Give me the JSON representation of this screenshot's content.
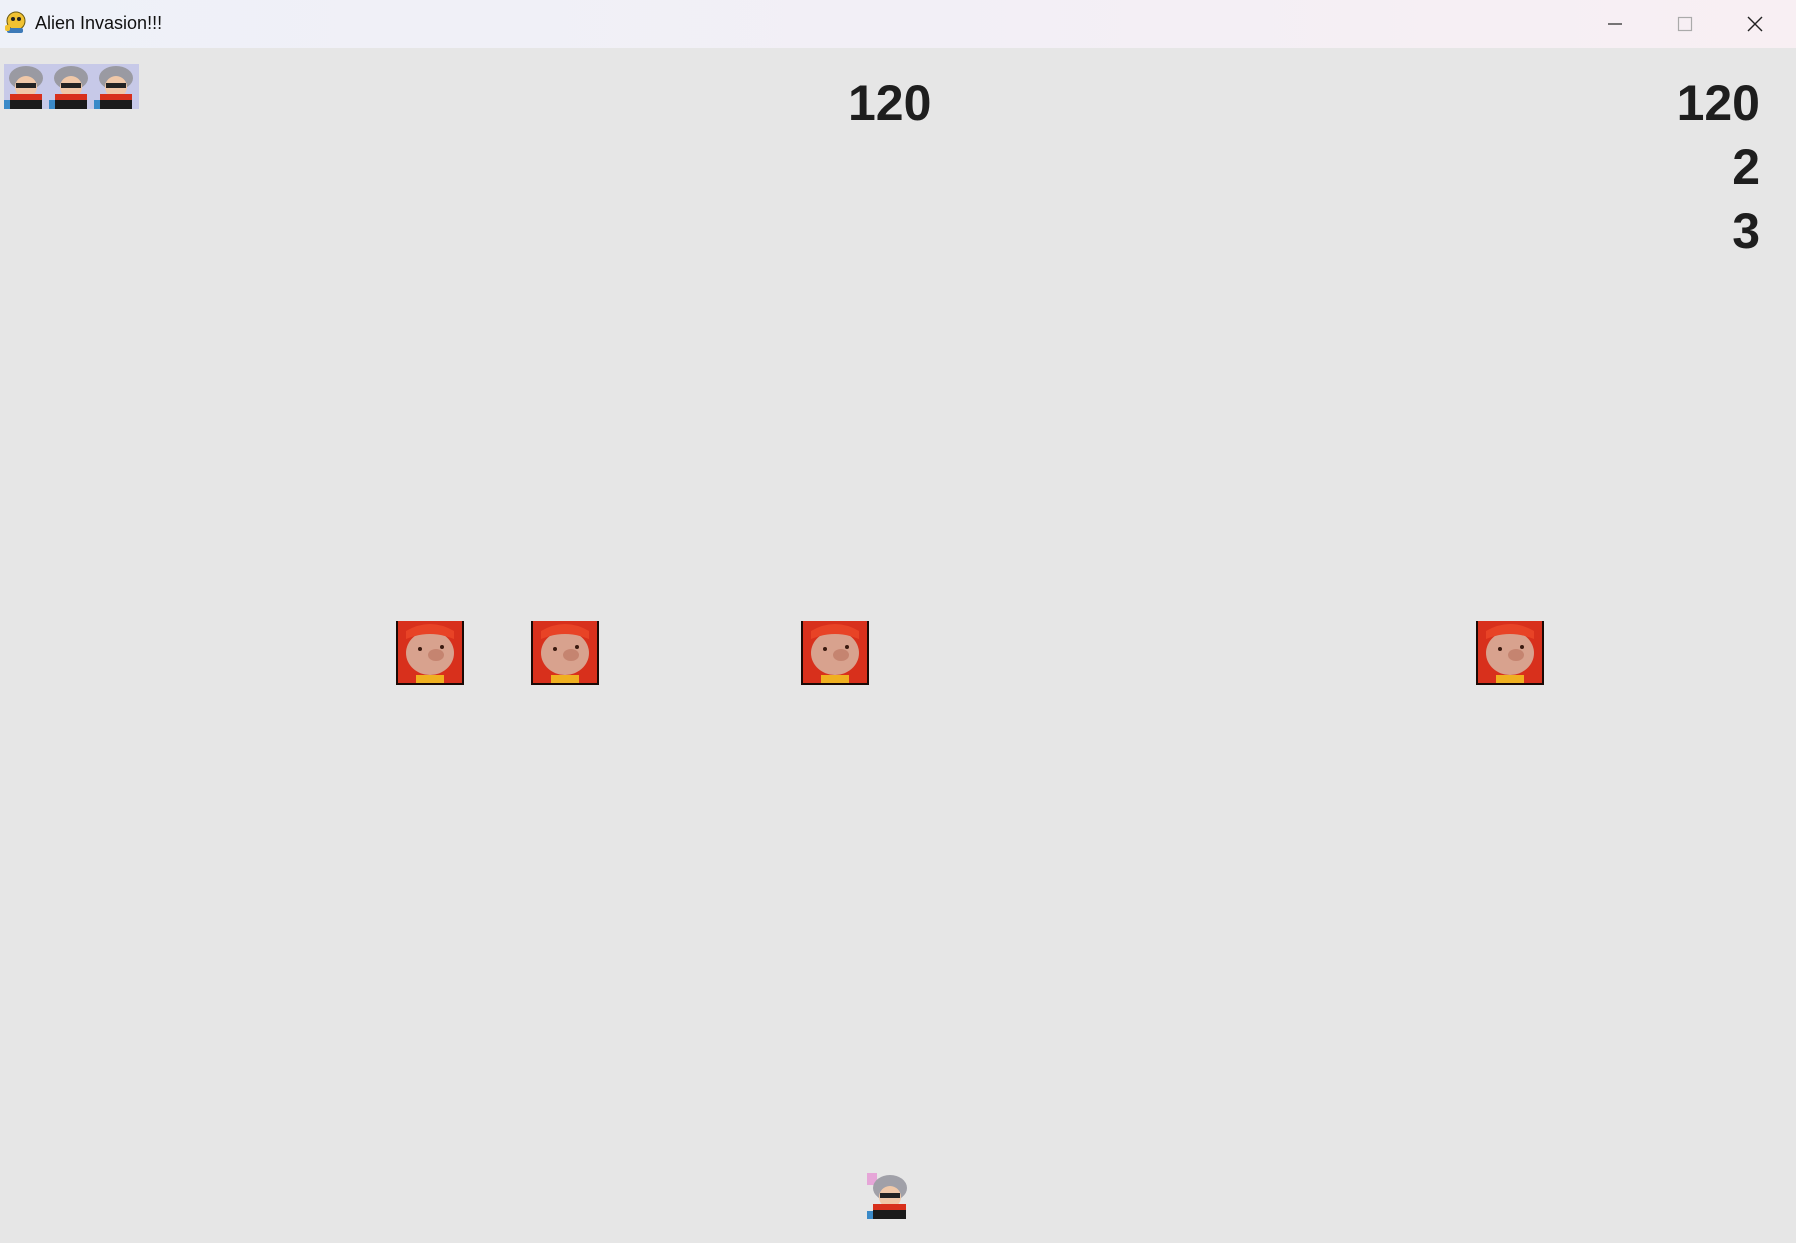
{
  "window": {
    "title": "Alien Invasion!!!",
    "app_icon": "python-icon",
    "controls": {
      "minimize": "minimize-icon",
      "maximize": "maximize-icon",
      "close": "close-icon"
    }
  },
  "hud": {
    "score": "120",
    "high_score": "120",
    "level": "2",
    "ships_left": "3",
    "lives_icons": [
      "ship-icon",
      "ship-icon",
      "ship-icon"
    ]
  },
  "aliens": [
    {
      "sprite": "pig-alien-icon"
    },
    {
      "sprite": "pig-alien-icon"
    },
    {
      "sprite": "pig-alien-icon"
    },
    {
      "sprite": "pig-alien-icon"
    }
  ],
  "player": {
    "sprite": "ship-icon"
  },
  "colors": {
    "background": "#e6e6e6",
    "text": "#1e1e1e",
    "alien_red": "#d8301c"
  }
}
